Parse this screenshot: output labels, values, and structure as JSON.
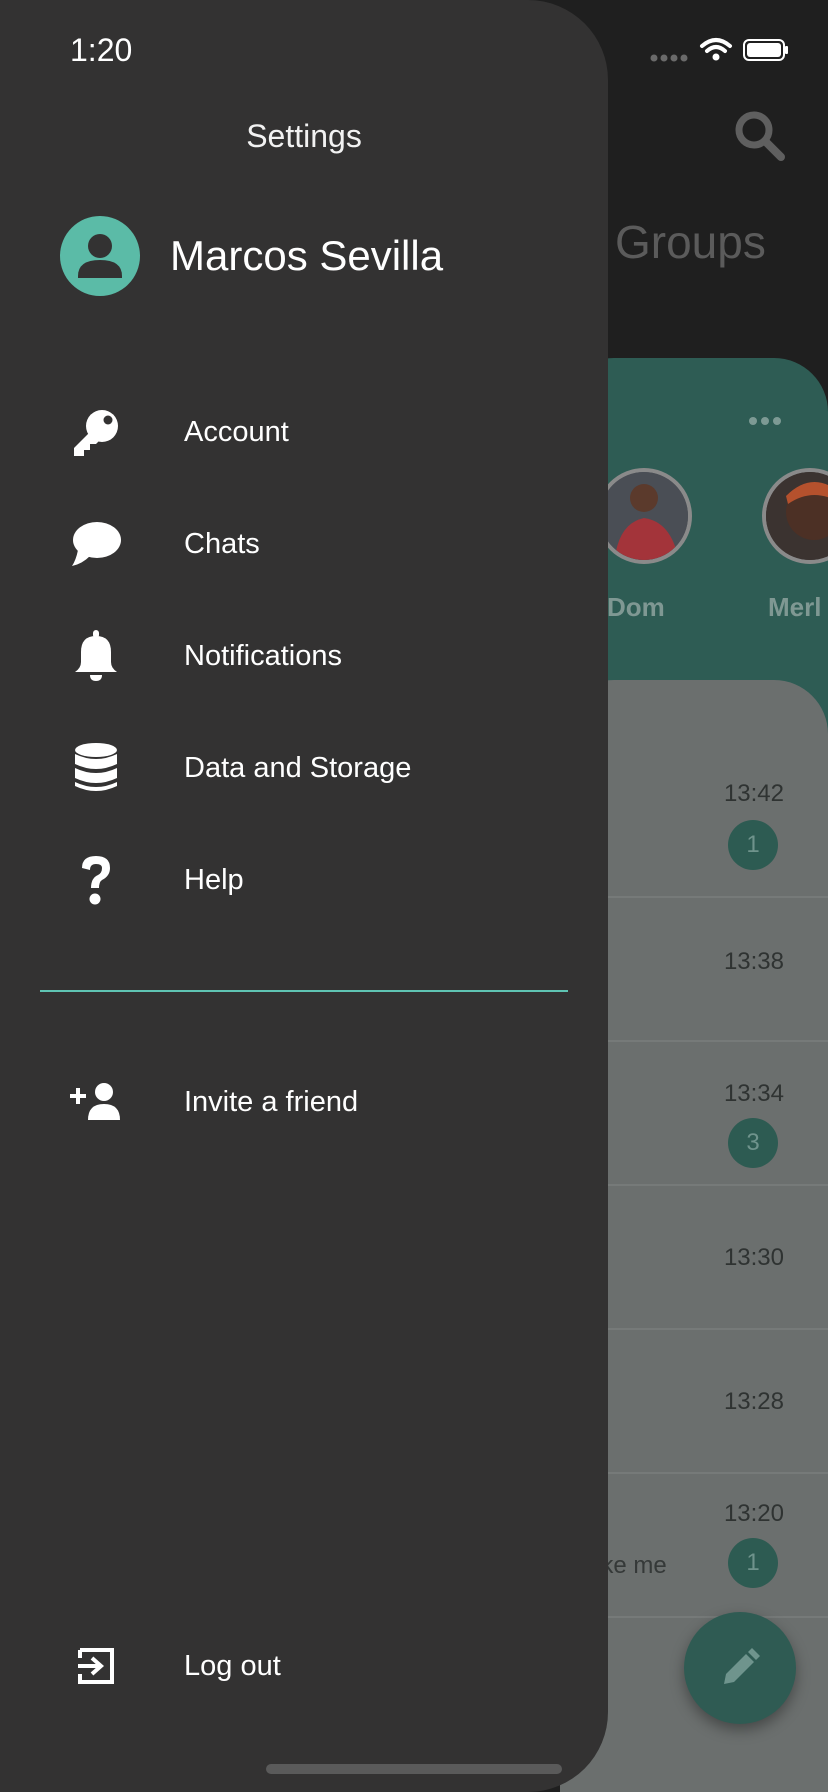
{
  "status_bar": {
    "time": "1:20"
  },
  "drawer": {
    "title": "Settings",
    "profile": {
      "name": "Marcos Sevilla",
      "avatar_icon": "person-icon"
    },
    "menu": [
      {
        "label": "Account",
        "icon": "key-icon"
      },
      {
        "label": "Chats",
        "icon": "chat-bubble-icon"
      },
      {
        "label": "Notifications",
        "icon": "bell-icon"
      },
      {
        "label": "Data and Storage",
        "icon": "database-icon"
      },
      {
        "label": "Help",
        "icon": "question-icon"
      }
    ],
    "invite": {
      "label": "Invite a friend",
      "icon": "add-person-icon"
    },
    "logout": {
      "label": "Log out",
      "icon": "logout-icon"
    },
    "accent_color": "#5fc4b3"
  },
  "background": {
    "tab_label": "Groups",
    "stories": [
      {
        "name": "Dom"
      },
      {
        "name": "Merl"
      }
    ],
    "chats": [
      {
        "time": "13:42",
        "badge": "1",
        "preview": ""
      },
      {
        "time": "13:38",
        "badge": "",
        "preview": ""
      },
      {
        "time": "13:34",
        "badge": "3",
        "preview": ""
      },
      {
        "time": "13:30",
        "badge": "",
        "preview": ""
      },
      {
        "time": "13:28",
        "badge": "",
        "preview": ""
      },
      {
        "time": "13:20",
        "badge": "1",
        "preview": "ike me"
      }
    ]
  }
}
